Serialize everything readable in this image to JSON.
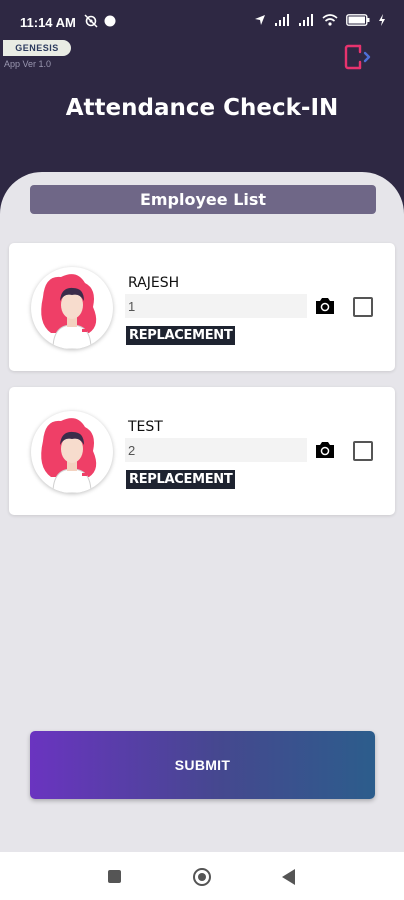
{
  "status_bar": {
    "time": "11:14 AM",
    "left_icons": [
      "settings-off-icon",
      "dot-icon"
    ],
    "right_icons": [
      "location-icon",
      "signal-icon",
      "signal-icon",
      "wifi-icon",
      "battery-icon",
      "charging-icon"
    ]
  },
  "app": {
    "logo_text": "GENESIS",
    "version": "App Ver 1.0",
    "title": "Attendance Check-IN",
    "logout_icon": "logout-icon",
    "accent_color": "#e7336e"
  },
  "list": {
    "header": "Employee List",
    "employees": [
      {
        "name": "RAJESH",
        "value": "1",
        "replacement_label": "REPLACEMENT",
        "checked": false
      },
      {
        "name": "TEST",
        "value": "2",
        "replacement_label": "REPLACEMENT",
        "checked": false
      }
    ]
  },
  "submit_label": "SUBMIT",
  "nav": {
    "icons": [
      "recent-apps-icon",
      "home-icon",
      "back-icon"
    ]
  }
}
